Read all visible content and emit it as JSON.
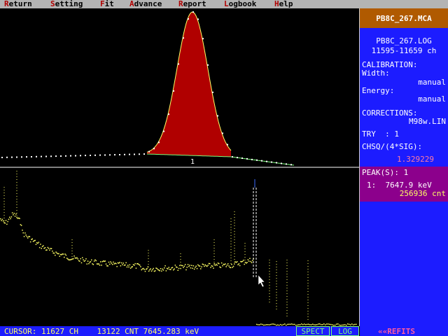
{
  "menu": {
    "items": [
      {
        "hot": "R",
        "rest": "eturn"
      },
      {
        "hot": "S",
        "rest": "etting"
      },
      {
        "hot": "F",
        "rest": "it"
      },
      {
        "hot": "A",
        "rest": "dvance"
      },
      {
        "hot": "R",
        "rest": "eport"
      },
      {
        "hot": "L",
        "rest": "ogbook"
      },
      {
        "hot": "H",
        "rest": "elp"
      }
    ]
  },
  "side": {
    "file": "PB8C_267.MCA",
    "log": "PB8C_267.LOG",
    "range": "11595-11659 ch",
    "calibration_label": "CALIBRATION:",
    "width_label": "Width:",
    "width_value": "manual",
    "energy_label": "Energy:",
    "energy_value": "manual",
    "corrections_label": "CORRECTIONS:",
    "corrections_value": "M98w.LIN",
    "try_label": "TRY  : 1",
    "chsq_label": "CHSQ/(4*SIG):",
    "chsq_value": "1.329229",
    "peaks_label": "PEAK(S): 1",
    "peak1_line": "1:  7647.9 keV",
    "peak1_counts": "256936 cnt",
    "refits": "««REFITS"
  },
  "status": {
    "cursor": "CURSOR: 11627 CH    13122 CNT 7645.283 keV",
    "spect": "SPECT",
    "log": "LOG"
  },
  "fit_plot": {
    "peak_marker": "1"
  },
  "colors": {
    "peak_fill": "#b00000",
    "data_points": "#ffffff",
    "fit_curve": "#ffff64",
    "background_curve": "#7cff7c",
    "spectrum": "#ffff64",
    "marker": "#3c6cff"
  }
}
